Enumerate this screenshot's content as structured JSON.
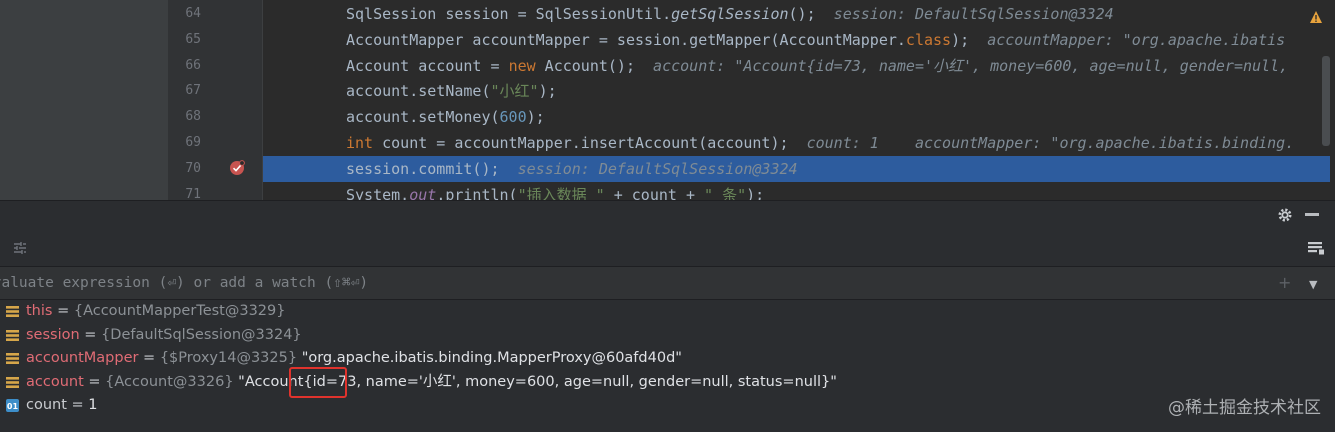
{
  "editor": {
    "lines": [
      {
        "num": "64",
        "segments": [
          {
            "t": "SqlSession session = SqlSessionUtil.",
            "c": ""
          },
          {
            "t": "getSqlSession",
            "c": "fn-i"
          },
          {
            "t": "();",
            "c": ""
          },
          {
            "t": "  session: DefaultSqlSession@3324",
            "c": "hint"
          }
        ]
      },
      {
        "num": "65",
        "segments": [
          {
            "t": "AccountMapper accountMapper = session.getMapper(AccountMapper.",
            "c": ""
          },
          {
            "t": "class",
            "c": "kw"
          },
          {
            "t": ");",
            "c": ""
          },
          {
            "t": "  accountMapper: \"org.apache.ibatis",
            "c": "hint"
          }
        ]
      },
      {
        "num": "66",
        "segments": [
          {
            "t": "Account account = ",
            "c": ""
          },
          {
            "t": "new",
            "c": "kw"
          },
          {
            "t": " Account();",
            "c": ""
          },
          {
            "t": "  account: \"Account{id=73, name='小红', money=600, age=null, gender=null,",
            "c": "hint"
          }
        ]
      },
      {
        "num": "67",
        "segments": [
          {
            "t": "account.setName(",
            "c": ""
          },
          {
            "t": "\"小红\"",
            "c": "str"
          },
          {
            "t": ");",
            "c": ""
          }
        ]
      },
      {
        "num": "68",
        "segments": [
          {
            "t": "account.setMoney(",
            "c": ""
          },
          {
            "t": "600",
            "c": "num"
          },
          {
            "t": ");",
            "c": ""
          }
        ]
      },
      {
        "num": "69",
        "segments": [
          {
            "t": "int",
            "c": "kw"
          },
          {
            "t": " count = accountMapper.insertAccount(account);",
            "c": ""
          },
          {
            "t": "  count: 1    accountMapper: \"org.apache.ibatis.binding.",
            "c": "hint"
          }
        ]
      },
      {
        "num": "70",
        "exec": true,
        "segments": [
          {
            "t": "session.commit();",
            "c": ""
          },
          {
            "t": "  session: DefaultSqlSession@3324",
            "c": "hint"
          }
        ]
      },
      {
        "num": "71",
        "segments": [
          {
            "t": "System.",
            "c": ""
          },
          {
            "t": "out",
            "c": "field"
          },
          {
            "t": ".println(",
            "c": ""
          },
          {
            "t": "\"插入数据 \"",
            "c": "str"
          },
          {
            "t": " + count + ",
            "c": ""
          },
          {
            "t": "\" 条\"",
            "c": "str"
          },
          {
            "t": ");",
            "c": ""
          }
        ]
      }
    ]
  },
  "evaluate": {
    "placeholder": "Evaluate expression (⏎) or add a watch (⇧⌘⏎)"
  },
  "variables": [
    {
      "name": "this",
      "kind": "field",
      "type": "{AccountMapperTest@3329}",
      "value": ""
    },
    {
      "name": "session",
      "kind": "field",
      "type": "{DefaultSqlSession@3324}",
      "value": ""
    },
    {
      "name": "accountMapper",
      "kind": "field",
      "type": "{$Proxy14@3325}",
      "value": "\"org.apache.ibatis.binding.MapperProxy@60afd40d\""
    },
    {
      "name": "account",
      "kind": "field",
      "type": "{Account@3326}",
      "value": "\"Account{id=73, name='小红', money=600, age=null, gender=null, status=null}\""
    },
    {
      "name": "count",
      "kind": "local",
      "type": "",
      "value": "1"
    }
  ],
  "watermark": "@稀土掘金技术社区",
  "colors": {
    "highlight_box": "#e0332d",
    "exec_line": "#2d5c9e",
    "field_var": "#e06c75"
  }
}
